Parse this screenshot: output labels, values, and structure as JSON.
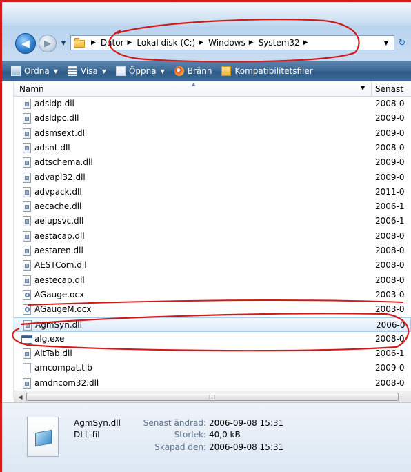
{
  "address_bar": {
    "crumbs": [
      "Dator",
      "Lokal disk (C:)",
      "Windows",
      "System32"
    ]
  },
  "toolbar": {
    "organize": "Ordna",
    "view": "Visa",
    "open": "Öppna",
    "burn": "Bränn",
    "compat": "Kompatibilitetsfiler"
  },
  "columns": {
    "name": "Namn",
    "date": "Senast"
  },
  "files": [
    {
      "name": "adsldp.dll",
      "date": "2008-0",
      "icon": "dll-file-icon"
    },
    {
      "name": "adsldpc.dll",
      "date": "2009-0",
      "icon": "dll-file-icon"
    },
    {
      "name": "adsmsext.dll",
      "date": "2009-0",
      "icon": "dll-file-icon"
    },
    {
      "name": "adsnt.dll",
      "date": "2008-0",
      "icon": "dll-file-icon"
    },
    {
      "name": "adtschema.dll",
      "date": "2009-0",
      "icon": "dll-file-icon"
    },
    {
      "name": "advapi32.dll",
      "date": "2009-0",
      "icon": "dll-file-icon"
    },
    {
      "name": "advpack.dll",
      "date": "2011-0",
      "icon": "dll-file-icon"
    },
    {
      "name": "aecache.dll",
      "date": "2006-1",
      "icon": "dll-file-icon"
    },
    {
      "name": "aelupsvc.dll",
      "date": "2006-1",
      "icon": "dll-file-icon"
    },
    {
      "name": "aestacap.dll",
      "date": "2008-0",
      "icon": "dll-file-icon"
    },
    {
      "name": "aestaren.dll",
      "date": "2008-0",
      "icon": "dll-file-icon"
    },
    {
      "name": "AESTCom.dll",
      "date": "2008-0",
      "icon": "dll-file-icon"
    },
    {
      "name": "aestecap.dll",
      "date": "2008-0",
      "icon": "dll-file-icon"
    },
    {
      "name": "AGauge.ocx",
      "date": "2003-0",
      "icon": "ocx-file-icon"
    },
    {
      "name": "AGaugeM.ocx",
      "date": "2003-0",
      "icon": "ocx-file-icon"
    },
    {
      "name": "AgmSyn.dll",
      "date": "2006-0",
      "icon": "dll-file-icon",
      "selected": true
    },
    {
      "name": "alg.exe",
      "date": "2008-0",
      "icon": "exe-file-icon"
    },
    {
      "name": "AltTab.dll",
      "date": "2006-1",
      "icon": "dll-file-icon"
    },
    {
      "name": "amcompat.tlb",
      "date": "2009-0",
      "icon": "tlb-file-icon"
    },
    {
      "name": "amdncom32.dll",
      "date": "2008-0",
      "icon": "dll-file-icon"
    }
  ],
  "scrollbar": {
    "grip": "III"
  },
  "details": {
    "name": "AgmSyn.dll",
    "type": "DLL-fil",
    "modified_label": "Senast ändrad:",
    "modified_value": "2006-09-08 15:31",
    "size_label": "Storlek:",
    "size_value": "40,0 kB",
    "created_label": "Skapad den:",
    "created_value": "2006-09-08 15:31"
  },
  "colors": {
    "annotation": "#d21a1a",
    "toolbar": "#3f6b98",
    "selection": "#dbeaf9"
  }
}
